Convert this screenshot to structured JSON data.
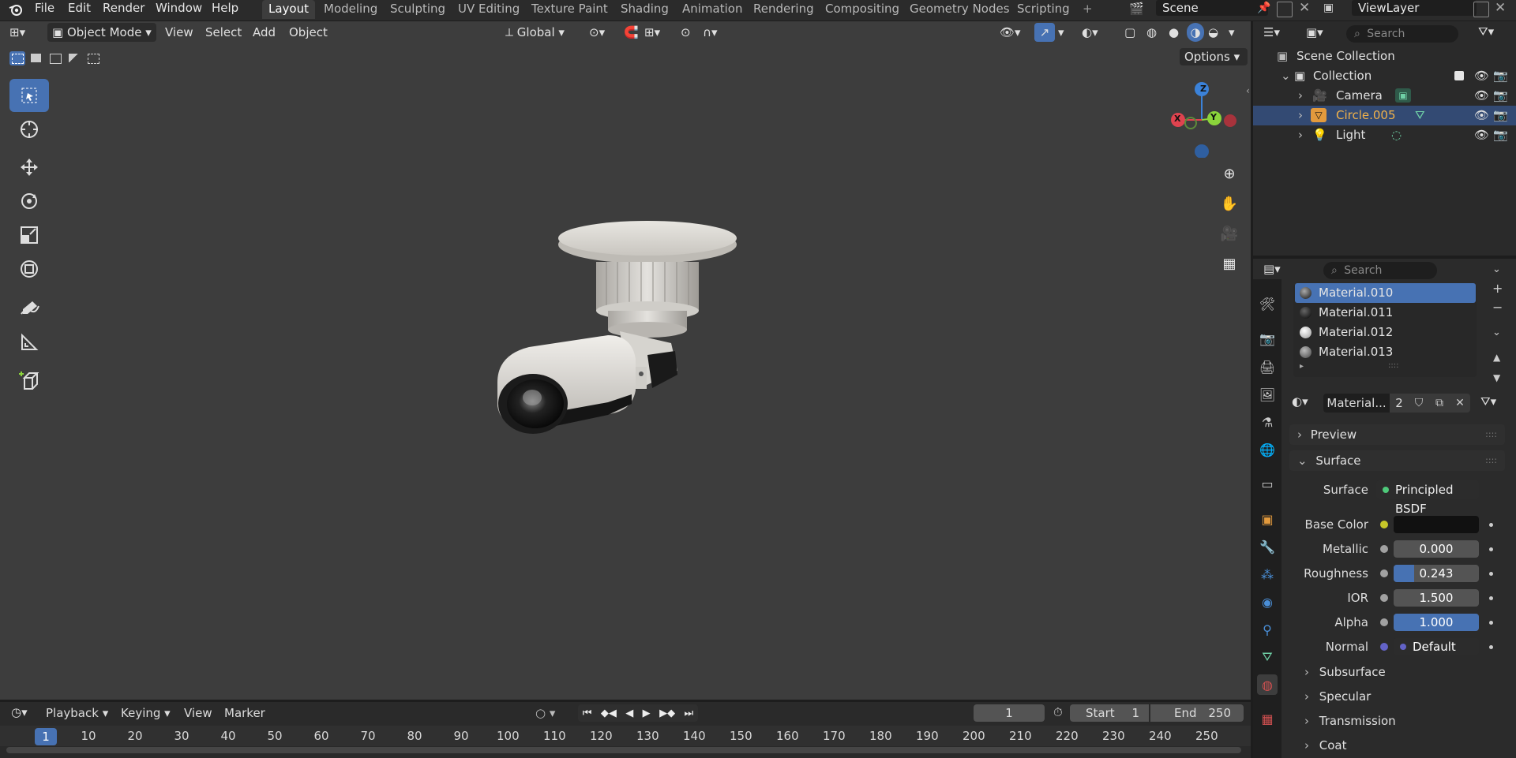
{
  "top_menu": {
    "items": [
      "File",
      "Edit",
      "Render",
      "Window",
      "Help"
    ]
  },
  "workspaces": {
    "tabs": [
      "Layout",
      "Modeling",
      "Sculpting",
      "UV Editing",
      "Texture Paint",
      "Shading",
      "Animation",
      "Rendering",
      "Compositing",
      "Geometry Nodes",
      "Scripting"
    ],
    "active": "Layout",
    "add_label": "+"
  },
  "scene": {
    "name": "Scene",
    "view_layer": "ViewLayer"
  },
  "viewport_header": {
    "mode": "Object Mode",
    "menus": [
      "View",
      "Select",
      "Add",
      "Object"
    ],
    "transform_orientation": "Global",
    "options_label": "Options"
  },
  "gizmo": {
    "x": "X",
    "y": "Y",
    "z": "Z"
  },
  "outliner": {
    "search_placeholder": "Search",
    "scene_collection": "Scene Collection",
    "collection": "Collection",
    "objects": [
      {
        "name": "Camera",
        "selected": false
      },
      {
        "name": "Circle.005",
        "selected": true
      },
      {
        "name": "Light",
        "selected": false
      }
    ]
  },
  "properties": {
    "search_placeholder": "Search",
    "materials": [
      "Material.010",
      "Material.011",
      "Material.012",
      "Material.013"
    ],
    "selected_material": "Material.010",
    "material_field": "Material...",
    "user_count": "2",
    "sections": {
      "preview": "Preview",
      "surface": "Surface"
    },
    "surface_shader_label": "Surface",
    "surface_shader": "Principled BSDF",
    "inputs": [
      {
        "label": "Base Color",
        "value": "",
        "fraction": 0
      },
      {
        "label": "Metallic",
        "value": "0.000",
        "fraction": 0
      },
      {
        "label": "Roughness",
        "value": "0.243",
        "fraction": 0.243
      },
      {
        "label": "IOR",
        "value": "1.500",
        "fraction": 0
      },
      {
        "label": "Alpha",
        "value": "1.000",
        "fraction": 1.0
      },
      {
        "label": "Normal",
        "value": "Default",
        "fraction": 0
      }
    ],
    "subsections": [
      "Subsurface",
      "Specular",
      "Transmission",
      "Coat"
    ]
  },
  "timeline": {
    "menus": [
      "Playback",
      "Keying",
      "View",
      "Marker"
    ],
    "current_frame": "1",
    "start_label": "Start",
    "start_value": "1",
    "end_label": "End",
    "end_value": "250",
    "ticks": [
      "1",
      "10",
      "20",
      "30",
      "40",
      "50",
      "60",
      "70",
      "80",
      "90",
      "100",
      "110",
      "120",
      "130",
      "140",
      "150",
      "160",
      "170",
      "180",
      "190",
      "200",
      "210",
      "220",
      "230",
      "240",
      "250"
    ]
  },
  "colors": {
    "accent": "#4772b3",
    "viewport_bg": "#3d3d3d",
    "panel_bg": "#2b2b2b",
    "axis_x": "#e0434f",
    "axis_y": "#8bd43b",
    "axis_z": "#3b82d9"
  }
}
